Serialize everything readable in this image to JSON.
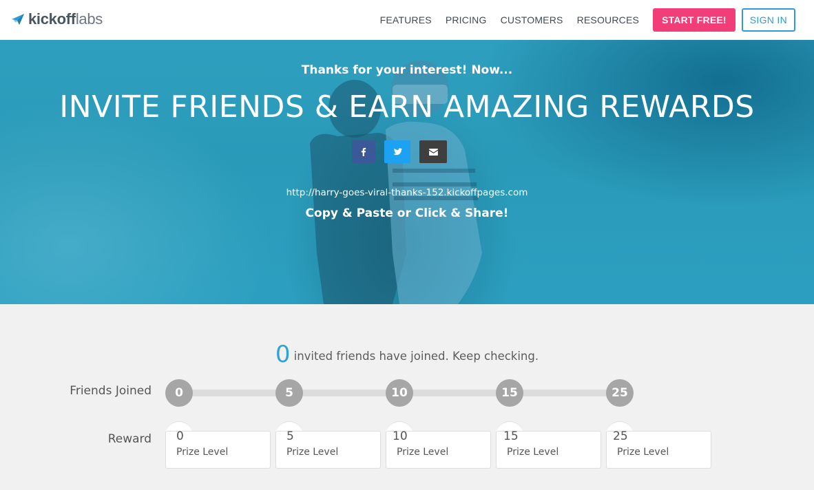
{
  "nav": {
    "logo_bold": "kickoff",
    "logo_light": "labs",
    "links": [
      "FEATURES",
      "PRICING",
      "CUSTOMERS",
      "RESOURCES"
    ],
    "start_label": "START FREE!",
    "signin_label": "SIGN IN",
    "colors": {
      "start": "#f23e78",
      "signin": "#2e9ad6"
    }
  },
  "hero": {
    "pretitle": "Thanks for your interest! Now...",
    "title": "INVITE FRIENDS & EARN AMAZING REWARDS",
    "share_icons": [
      "facebook-icon",
      "twitter-icon",
      "email-icon"
    ],
    "share_url": "http://harry-goes-viral-thanks-152.kickoffpages.com",
    "cta": "Copy & Paste or Click & Share!",
    "colors": {
      "facebook": "#3b5998",
      "twitter": "#1da1f2",
      "email": "#3f3f3f"
    }
  },
  "rewards": {
    "count": "0",
    "count_text": "invited friends have joined. Keep checking.",
    "friends_label": "Friends Joined",
    "reward_label": "Reward",
    "milestones": [
      "0",
      "5",
      "10",
      "15",
      "25"
    ],
    "cards": [
      {
        "num": "0",
        "level": "Prize Level"
      },
      {
        "num": "5",
        "level": "Prize Level"
      },
      {
        "num": "10",
        "level": "Prize Level"
      },
      {
        "num": "15",
        "level": "Prize Level"
      },
      {
        "num": "25",
        "level": "Prize Level"
      }
    ],
    "colors": {
      "count": "#2ea3d6",
      "milestone": "#a6a6a6"
    }
  }
}
